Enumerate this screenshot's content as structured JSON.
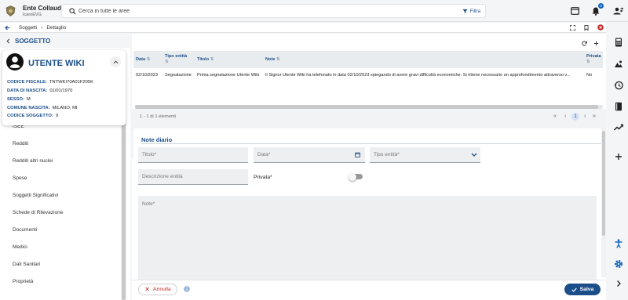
{
  "header": {
    "org_title": "Ente Collaudo",
    "org_subtitle": "IcaroEVG",
    "search_placeholder": "Cerca in tutte le aree",
    "filter_label": "Filtra",
    "notification_count": "0"
  },
  "breadcrumb": {
    "items": [
      "Soggetti",
      "Dettaglio"
    ]
  },
  "left": {
    "section_title": "SOGGETTO",
    "user_name": "UTENTE WIKI",
    "info": [
      {
        "label": "CODICE FISCALE:",
        "value": "TNTWKI70A01F205K"
      },
      {
        "label": "DATA DI NASCITA:",
        "value": "01/01/1970"
      },
      {
        "label": "SESSO:",
        "value": "M"
      },
      {
        "label": "COMUNE NASCITA:",
        "value": "MILANO, MI"
      },
      {
        "label": "CODICE SOGGETTO:",
        "value": "9"
      }
    ],
    "menu": [
      "ISEE",
      "Redditi",
      "Redditi altri nuclei",
      "Spese",
      "Soggetti Significativi",
      "Schede di Rilevazione",
      "Documenti",
      "Medici",
      "Dati Sanitari",
      "Proprietà"
    ]
  },
  "table": {
    "columns": [
      "Data",
      "Tipo entità",
      "Titolo",
      "Note",
      "Privata"
    ],
    "rows": [
      {
        "data": "02/10/2023",
        "tipo": "Segnalazione",
        "titolo": "Prima segnalazione Utente Wiki",
        "note": "Il Signor Utente Wiki ha telefonato in data 02/10/2023 spiegando di avere gravi difficoltà economiche. Si ritiene necessario un approfondimento attraverso v...",
        "privata": "No"
      }
    ],
    "pager_text": "1 - 1 di 1 elementi",
    "current_page": "1"
  },
  "form": {
    "title": "Note diario",
    "titolo_placeholder": "Titolo*",
    "data_placeholder": "Data*",
    "tipo_placeholder": "Tipo entità*",
    "descrizione_placeholder": "Descrizione entità",
    "privata_label": "Privata*",
    "privata_checked": false,
    "note_placeholder": "Note*"
  },
  "footer": {
    "cancel_label": "Annulla",
    "save_label": "Salva"
  },
  "colors": {
    "primary": "#1b4f8a",
    "danger": "#c62828",
    "accent": "#1565c0"
  }
}
